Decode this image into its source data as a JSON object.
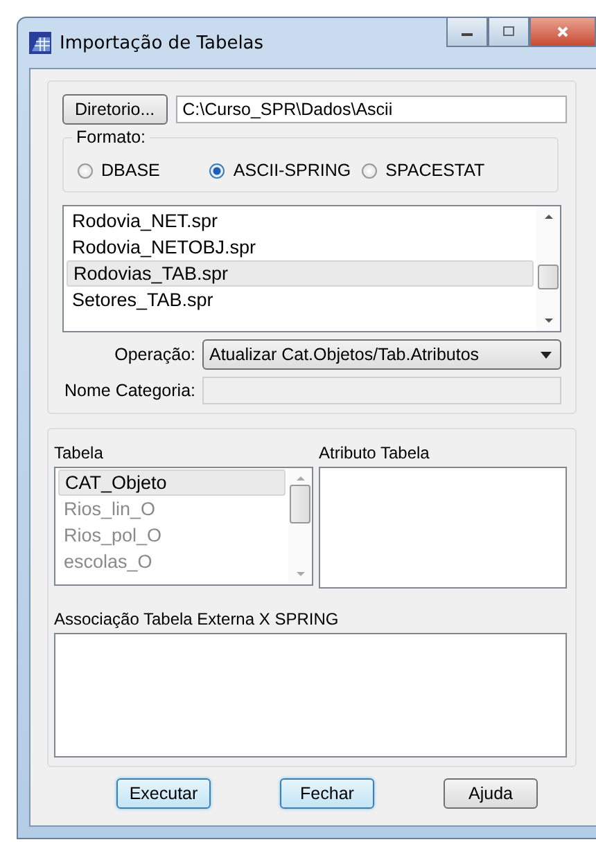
{
  "window": {
    "title": "Importação de Tabelas"
  },
  "directory_button": "Diretorio...",
  "directory_path": "C:\\Curso_SPR\\Dados\\Ascii",
  "format": {
    "legend": "Formato:",
    "options": [
      {
        "label": "DBASE",
        "selected": false
      },
      {
        "label": "ASCII-SPRING",
        "selected": true
      },
      {
        "label": "SPACESTAT",
        "selected": false
      }
    ]
  },
  "files": [
    {
      "name": "Rodovia_NET.spr",
      "selected": false
    },
    {
      "name": "Rodovia_NETOBJ.spr",
      "selected": false
    },
    {
      "name": "Rodovias_TAB.spr",
      "selected": true
    },
    {
      "name": "Setores_TAB.spr",
      "selected": false
    }
  ],
  "operation": {
    "label": "Operação:",
    "value": "Atualizar Cat.Objetos/Tab.Atributos"
  },
  "category_name": {
    "label": "Nome Categoria:"
  },
  "tables": {
    "label": "Tabela",
    "items": [
      {
        "name": "CAT_Objeto",
        "selected": true,
        "disabled": false
      },
      {
        "name": "Rios_lin_O",
        "selected": false,
        "disabled": true
      },
      {
        "name": "Rios_pol_O",
        "selected": false,
        "disabled": true
      },
      {
        "name": "escolas_O",
        "selected": false,
        "disabled": true
      }
    ]
  },
  "attributes": {
    "label": "Atributo Tabela"
  },
  "association": {
    "label": "Associação Tabela Externa X SPRING"
  },
  "buttons": [
    {
      "label": "Executar",
      "highlighted": true
    },
    {
      "label": "Fechar",
      "highlighted": true
    },
    {
      "label": "Ajuda",
      "highlighted": false
    }
  ]
}
